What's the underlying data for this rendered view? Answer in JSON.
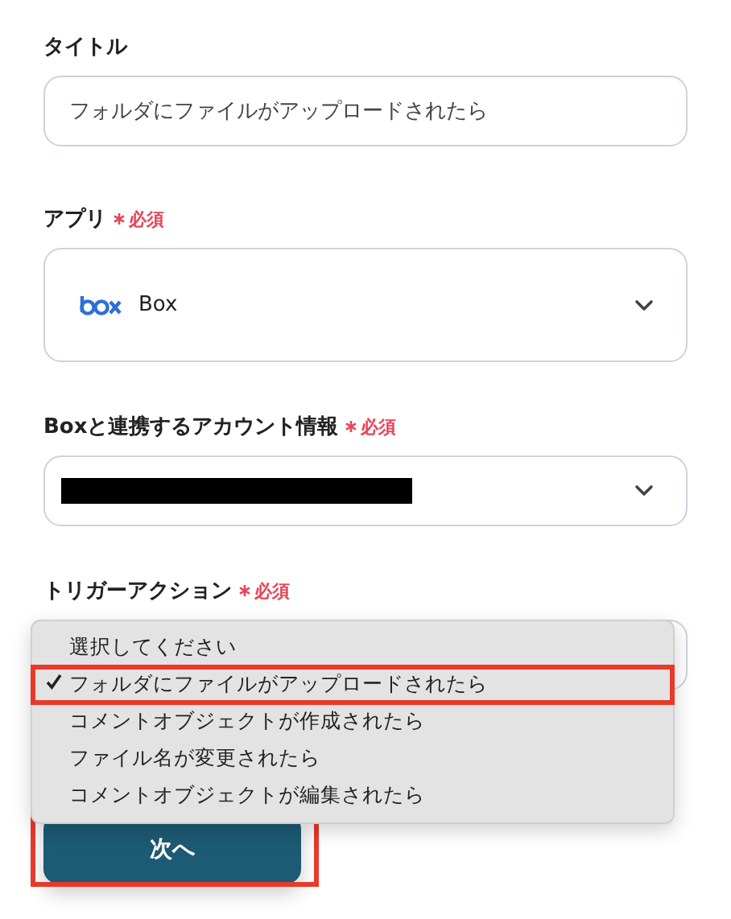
{
  "title_field": {
    "label": "タイトル",
    "value": "フォルダにファイルがアップロードされたら"
  },
  "app_field": {
    "label": "アプリ",
    "required": "必須",
    "value": "Box"
  },
  "account_field": {
    "label": "Boxと連携するアカウント情報",
    "required": "必須",
    "redacted": true
  },
  "trigger_field": {
    "label": "トリガーアクション",
    "required": "必須"
  },
  "trigger_menu": {
    "options": [
      {
        "label": "選択してください",
        "selected": false,
        "highlighted": false
      },
      {
        "label": "フォルダにファイルがアップロードされたら",
        "selected": true,
        "highlighted": true
      },
      {
        "label": "コメントオブジェクトが作成されたら",
        "selected": false,
        "highlighted": false
      },
      {
        "label": "ファイル名が変更されたら",
        "selected": false,
        "highlighted": false
      },
      {
        "label": "コメントオブジェクトが編集されたら",
        "selected": false,
        "highlighted": false
      }
    ]
  },
  "next_button": {
    "label": "次へ",
    "highlighted": true
  }
}
